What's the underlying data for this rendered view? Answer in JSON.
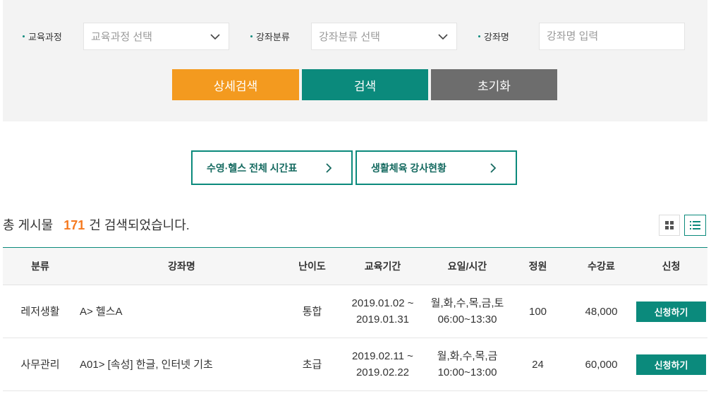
{
  "colors": {
    "teal": "#0b8a7c",
    "orange": "#f39a1f",
    "gray": "#6d6d6d",
    "count_highlight": "#f57a20",
    "link_text": "#156a60"
  },
  "search": {
    "course_type": {
      "label": "교육과정",
      "placeholder": "교육과정 선택",
      "icon": "chevron-down-icon"
    },
    "category": {
      "label": "강좌분류",
      "placeholder": "강좌분류 선택",
      "icon": "chevron-down-icon"
    },
    "course_name": {
      "label": "강좌명",
      "placeholder": "강좌명 입력"
    },
    "buttons": {
      "detail": "상세검색",
      "search": "검색",
      "reset": "초기화"
    }
  },
  "quick_links": [
    {
      "label": "수영·헬스 전체 시간표",
      "icon": "chevron-right-icon"
    },
    {
      "label": "생활체육 강사현황",
      "icon": "chevron-right-icon"
    }
  ],
  "result": {
    "prefix": "총 게시물",
    "count": "171",
    "suffix": "건 검색되었습니다."
  },
  "view_modes": [
    {
      "icon": "grid-icon",
      "active": false
    },
    {
      "icon": "list-icon",
      "active": true
    }
  ],
  "table": {
    "headers": [
      "분류",
      "강좌명",
      "난이도",
      "교육기간",
      "요일/시간",
      "정원",
      "수강료",
      "신청"
    ],
    "rows": [
      {
        "category": "레저생활",
        "course": "A> 헬스A",
        "level": "통합",
        "period_start": "2019.01.02 ~",
        "period_end": "2019.01.31",
        "days": "월,화,수,목,금,토",
        "time": "06:00~13:30",
        "capacity": "100",
        "fee": "48,000",
        "apply": "신청하기"
      },
      {
        "category": "사무관리",
        "course": "A01> [속성] 한글, 인터넷 기초",
        "level": "초급",
        "period_start": "2019.02.11 ~",
        "period_end": "2019.02.22",
        "days": "월,화,수,목,금",
        "time": "10:00~13:00",
        "capacity": "24",
        "fee": "60,000",
        "apply": "신청하기"
      }
    ]
  }
}
